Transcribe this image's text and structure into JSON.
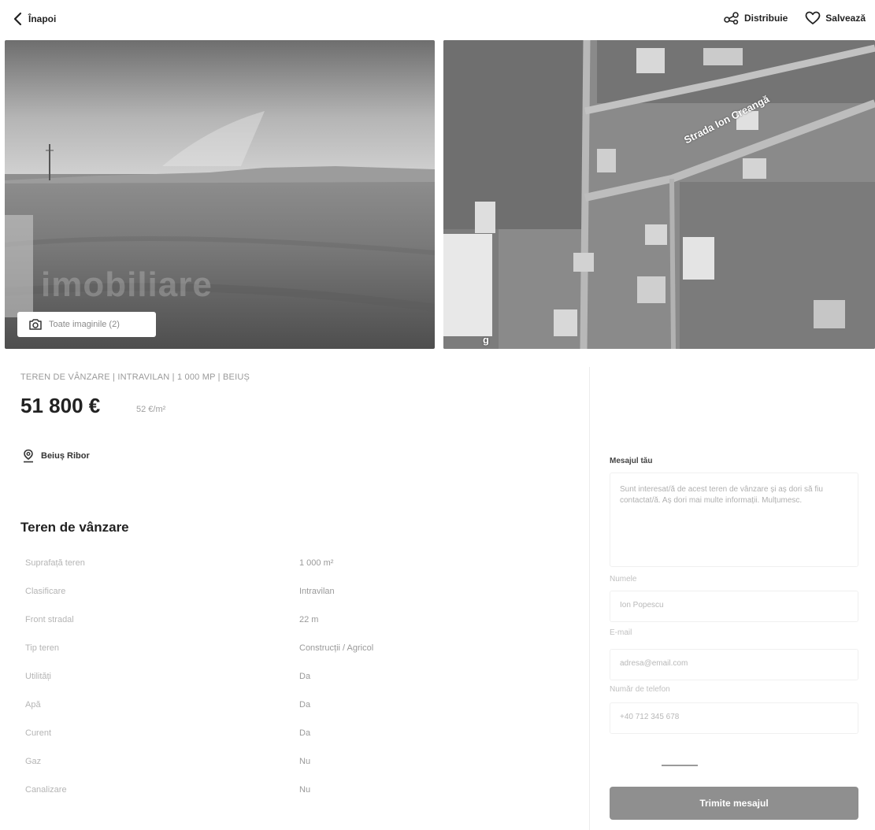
{
  "header": {
    "back_label": "Înapoi",
    "share_label": "Distribuie",
    "save_label": "Salvează"
  },
  "gallery": {
    "watermark": "imobiliare",
    "all_images_label": "Toate imaginile (2)",
    "map_street_label": "Strada Ion Creangă",
    "map_logo": "g"
  },
  "listing": {
    "breadcrumb": "TEREN DE VÂNZARE | INTRAVILAN | 1 000 MP | BEIUȘ",
    "price": "51 800 €",
    "price_per_sqm": "52 €/m²",
    "location": "Beiuș Ribor",
    "section_title": "Teren de vânzare",
    "specs": [
      {
        "label": "Suprafață teren",
        "value": "1 000 m²"
      },
      {
        "label": "Clasificare",
        "value": "Intravilan"
      },
      {
        "label": "Front stradal",
        "value": "22 m"
      },
      {
        "label": "Tip teren",
        "value": "Construcții / Agricol"
      },
      {
        "label": "Utilități",
        "value": "Da"
      },
      {
        "label": "Apă",
        "value": "Da"
      },
      {
        "label": "Curent",
        "value": "Da"
      },
      {
        "label": "Gaz",
        "value": "Nu"
      },
      {
        "label": "Canalizare",
        "value": "Nu"
      }
    ]
  },
  "contact": {
    "message_label": "Mesajul tău",
    "message_text": "Sunt interesat/ă de acest teren de vânzare și aș dori să fiu contactat/ă. Aș dori mai multe informații. Mulțumesc.",
    "name_label": "Numele",
    "name_value": "Ion Popescu",
    "email_label": "E-mail",
    "email_placeholder": "adresa@email.com",
    "phone_label": "Număr de telefon",
    "phone_placeholder": "+40 712 345 678",
    "send_label": "Trimite mesajul"
  }
}
